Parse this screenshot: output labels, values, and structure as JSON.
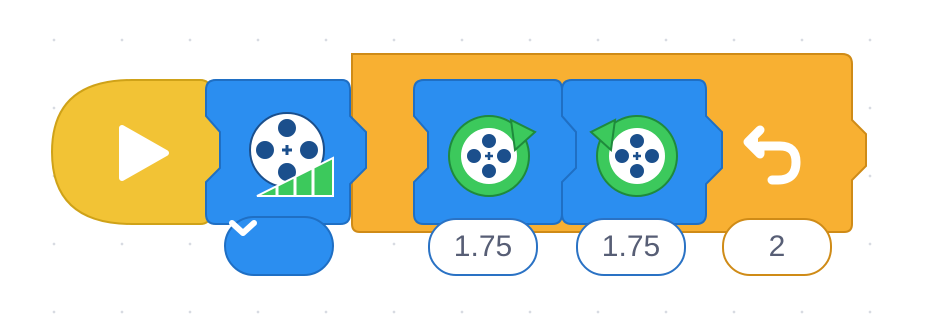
{
  "blocks": {
    "start": {
      "icon": "play-icon"
    },
    "motor_power": {
      "icon": "motor-power-icon",
      "dropdown_icon": "chevron-down-icon"
    },
    "repeat_loop": {
      "icon": "repeat-icon",
      "count": "2"
    },
    "motor_clockwise": {
      "icon": "motor-clockwise-icon",
      "value": "1.75"
    },
    "motor_counterclockwise": {
      "icon": "motor-counterclockwise-icon",
      "value": "1.75"
    }
  },
  "colors": {
    "start_yellow": "#f2c335",
    "motion_blue": "#2b8ef0",
    "control_orange": "#f8b032",
    "arrow_green": "#3cc95c",
    "text_gray": "#575e75"
  }
}
